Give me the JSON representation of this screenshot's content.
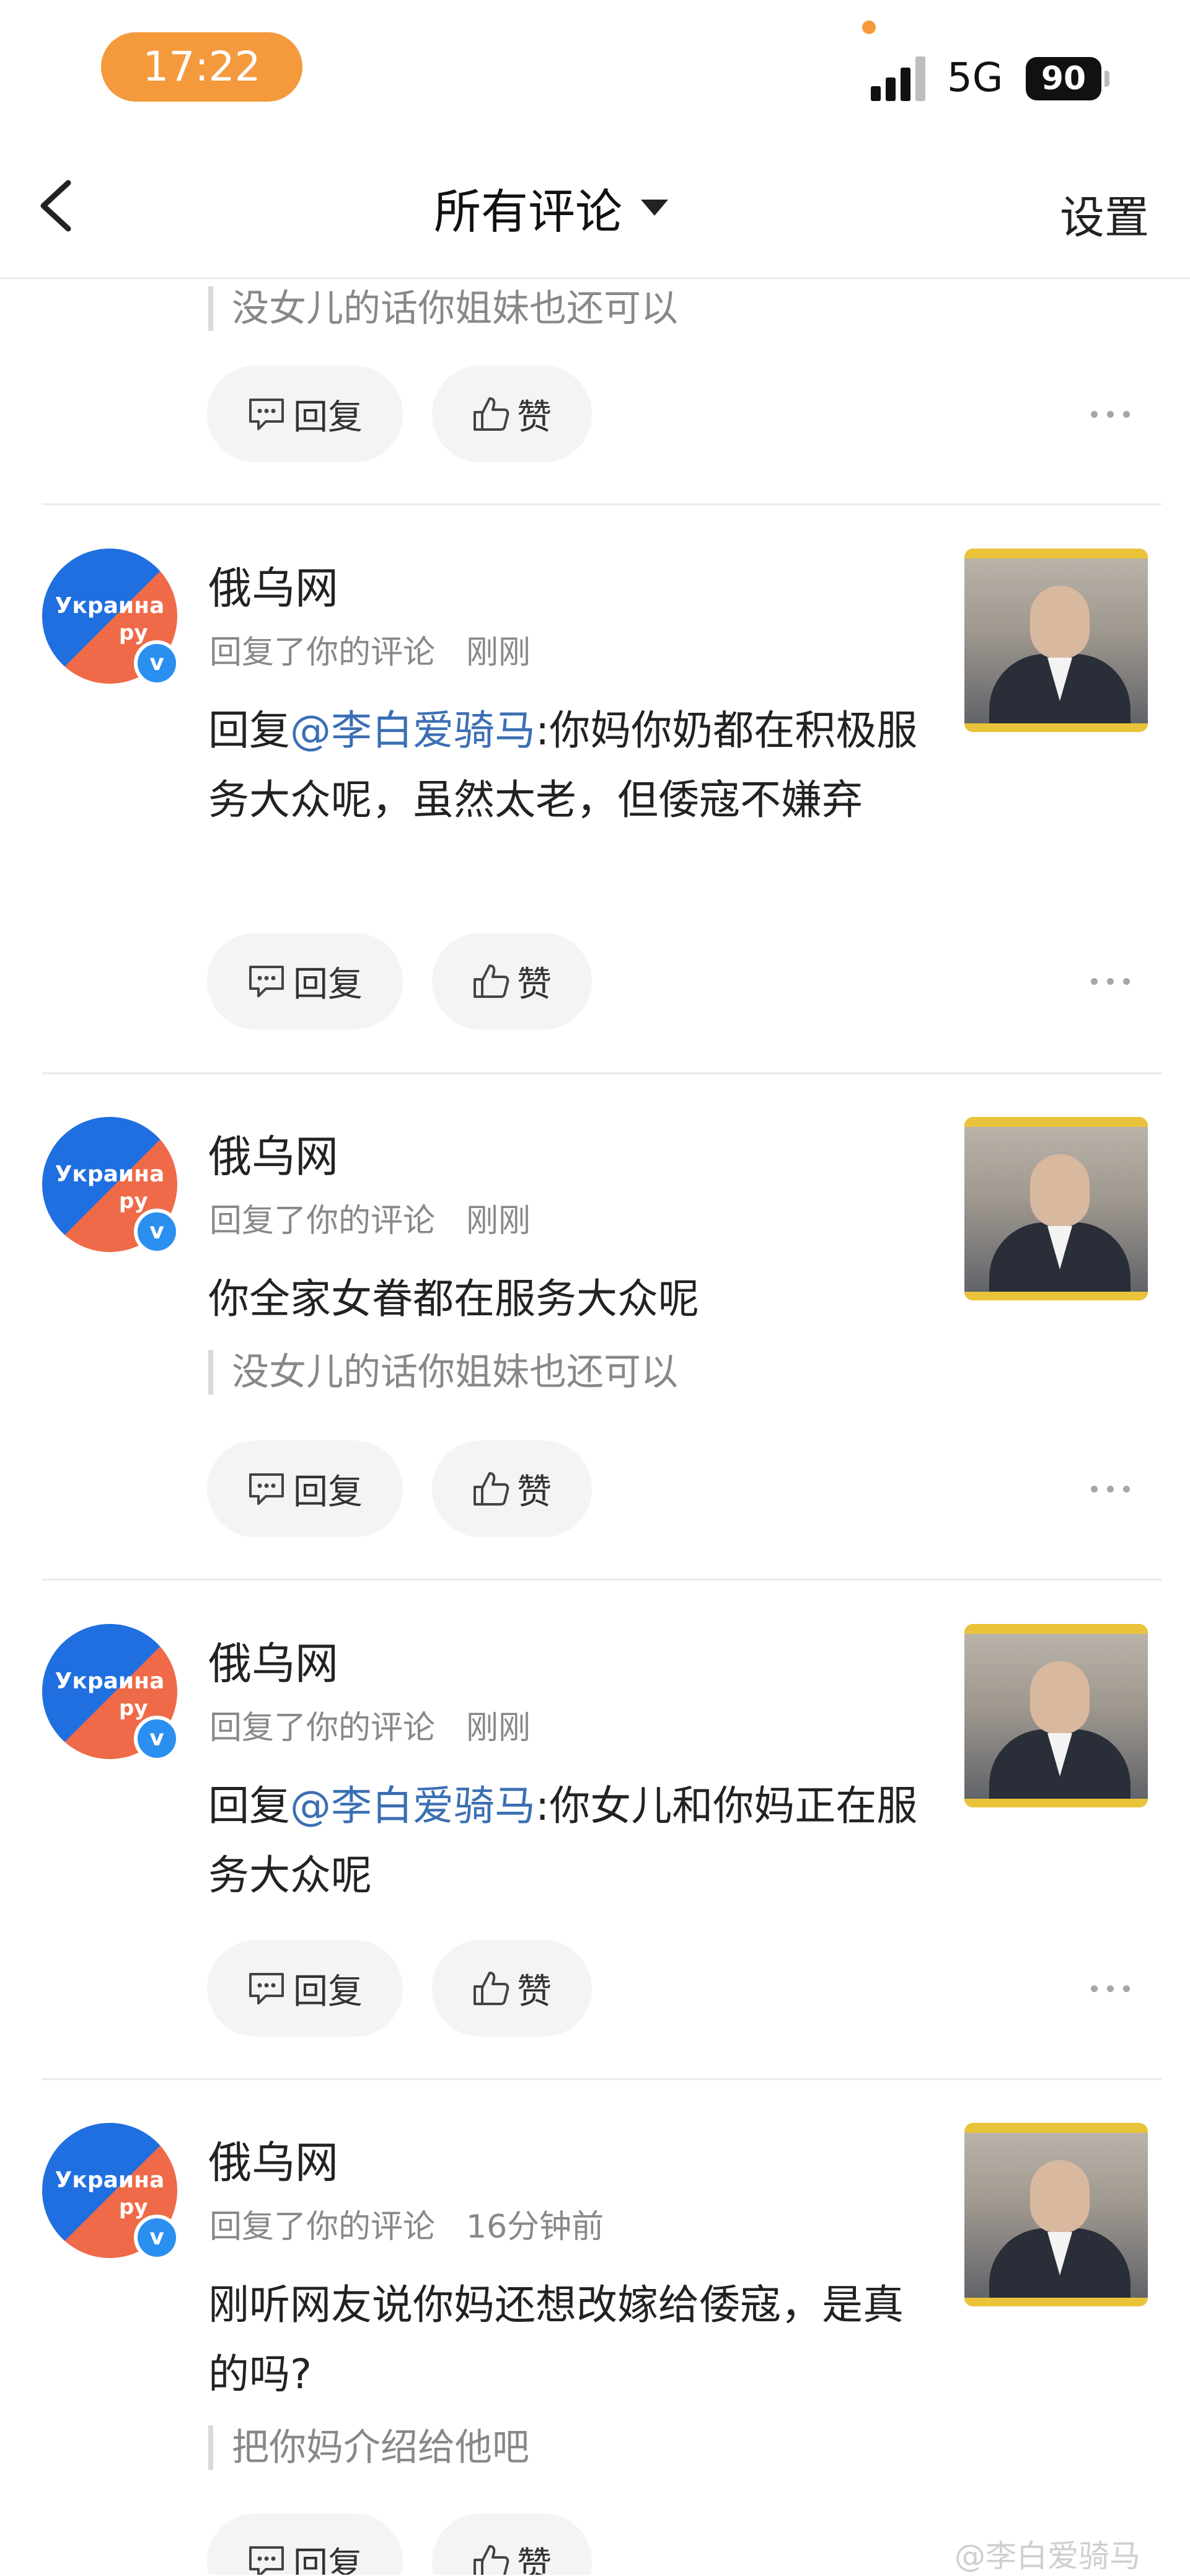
{
  "status_bar": {
    "time": "17:22",
    "network": "5G",
    "battery": "90",
    "icons": [
      "signal-icon",
      "battery-icon"
    ]
  },
  "nav": {
    "back_icon": "chevron-left-icon",
    "title": "所有评论",
    "settings": "设置"
  },
  "feed": {
    "top_partial": {
      "quote": "没女儿的话你姐妹也还可以",
      "reply_label": "回复",
      "like_label": "赞"
    },
    "comments": [
      {
        "avatar_text": "Украина",
        "avatar_text2": "ру",
        "name": "俄乌网",
        "meta": "回复了你的评论",
        "time": "刚刚",
        "reply_prefix": "回复",
        "mention": "@李白爱骑马",
        "text": ":你妈你奶都在积极服务大众呢，虽然太老，但倭寇不嫌弃",
        "quote": "",
        "reply_label": "回复",
        "like_label": "赞"
      },
      {
        "avatar_text": "Украина",
        "avatar_text2": "ру",
        "name": "俄乌网",
        "meta": "回复了你的评论",
        "time": "刚刚",
        "reply_prefix": "",
        "mention": "",
        "text": "你全家女眷都在服务大众呢",
        "quote": "没女儿的话你姐妹也还可以",
        "reply_label": "回复",
        "like_label": "赞"
      },
      {
        "avatar_text": "Украина",
        "avatar_text2": "ру",
        "name": "俄乌网",
        "meta": "回复了你的评论",
        "time": "刚刚",
        "reply_prefix": "回复",
        "mention": "@李白爱骑马",
        "text": ":你女儿和你妈正在服务大众呢",
        "quote": "",
        "reply_label": "回复",
        "like_label": "赞"
      },
      {
        "avatar_text": "Украина",
        "avatar_text2": "ру",
        "name": "俄乌网",
        "meta": "回复了你的评论",
        "time": "16分钟前",
        "reply_prefix": "",
        "mention": "",
        "text": "刚听网友说你妈还想改嫁给倭寇，是真的吗?",
        "quote": "把你妈介绍给他吧",
        "reply_label": "回复",
        "like_label": "赞"
      }
    ]
  },
  "watermark": "@李白爱骑马"
}
